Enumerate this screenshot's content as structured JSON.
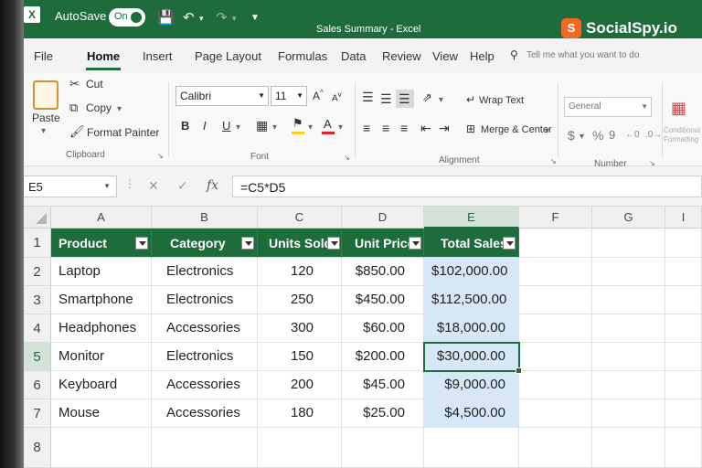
{
  "titlebar": {
    "autosave_label": "AutoSave",
    "autosave_state": "On",
    "window_title": "Sales Summary  -  Excel",
    "brand": "SocialSpy.io"
  },
  "menu": {
    "tabs": [
      "File",
      "Home",
      "Insert",
      "Page Layout",
      "Formulas",
      "Data",
      "Review",
      "View",
      "Help"
    ],
    "active_tab": "Home",
    "tell_me": "Tell me what you want to do"
  },
  "ribbon": {
    "clipboard": {
      "paste": "Paste",
      "cut": "Cut",
      "copy": "Copy",
      "format_painter": "Format Painter",
      "label": "Clipboard"
    },
    "font": {
      "name": "Calibri",
      "size": "11",
      "bold": "B",
      "italic": "I",
      "underline": "U",
      "label": "Font",
      "highlight_color": "#f7d21e",
      "font_color": "#d9262b"
    },
    "alignment": {
      "wrap_text": "Wrap Text",
      "merge_center": "Merge & Center",
      "label": "Alignment"
    },
    "number": {
      "format": "General",
      "label": "Number",
      "currency": "$",
      "percent": "%",
      "comma": "9"
    },
    "styles": {
      "conditional_formatting": "Conditional Formatting"
    }
  },
  "formula_bar": {
    "name_box": "E5",
    "fx": "fx",
    "formula": "=C5*D5"
  },
  "sheet": {
    "columns": [
      "A",
      "B",
      "C",
      "D",
      "E",
      "F",
      "G",
      "I"
    ],
    "rows": [
      "1",
      "2",
      "3",
      "4",
      "5",
      "6",
      "7",
      "8"
    ],
    "header_color": "#1e6b3c",
    "total_fill_color": "#d6e8f8",
    "headers": [
      "Product",
      "Category",
      "Units Sold",
      "Unit Price",
      "Total Sales"
    ],
    "data": [
      [
        "Laptop",
        "Electronics",
        "120",
        "$850.00",
        "$102,000.00"
      ],
      [
        "Smartphone",
        "Electronics",
        "250",
        "$450.00",
        "$112,500.00"
      ],
      [
        "Headphones",
        "Accessories",
        "300",
        "$60.00",
        "$18,000.00"
      ],
      [
        "Monitor",
        "Electronics",
        "150",
        "$200.00",
        "$30,000.00"
      ],
      [
        "Keyboard",
        "Accessories",
        "200",
        "$45.00",
        "$9,000.00"
      ],
      [
        "Mouse",
        "Accessories",
        "180",
        "$25.00",
        "$4,500.00"
      ]
    ],
    "active_cell": "E5"
  }
}
